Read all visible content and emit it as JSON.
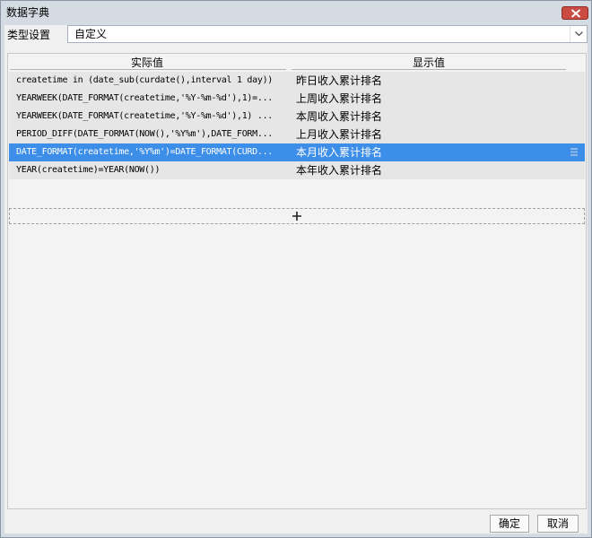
{
  "window": {
    "title": "数据字典"
  },
  "type_setting": {
    "label": "类型设置",
    "value": "自定义"
  },
  "table": {
    "headers": {
      "actual": "实际值",
      "display": "显示值"
    },
    "rows": [
      {
        "actual": "createtime in (date_sub(curdate(),interval 1 day))",
        "display": "昨日收入累计排名",
        "selected": false
      },
      {
        "actual": "YEARWEEK(DATE_FORMAT(createtime,'%Y-%m-%d'),1)=...",
        "display": "上周收入累计排名",
        "selected": false
      },
      {
        "actual": "YEARWEEK(DATE_FORMAT(createtime,'%Y-%m-%d'),1) ...",
        "display": "本周收入累计排名",
        "selected": false
      },
      {
        "actual": "PERIOD_DIFF(DATE_FORMAT(NOW(),'%Y%m'),DATE_FORM...",
        "display": "上月收入累计排名",
        "selected": false
      },
      {
        "actual": "DATE_FORMAT(createtime,'%Y%m')=DATE_FORMAT(CURD...",
        "display": "本月收入累计排名",
        "selected": true
      },
      {
        "actual": "YEAR(createtime)=YEAR(NOW())",
        "display": "本年收入累计排名",
        "selected": false
      }
    ],
    "add_symbol": "+"
  },
  "buttons": {
    "ok": "确定",
    "cancel": "取消"
  },
  "colors": {
    "selected_row": "#3d8ee9",
    "close_button": "#c94b42",
    "title_bar": "#d5dbe3"
  }
}
